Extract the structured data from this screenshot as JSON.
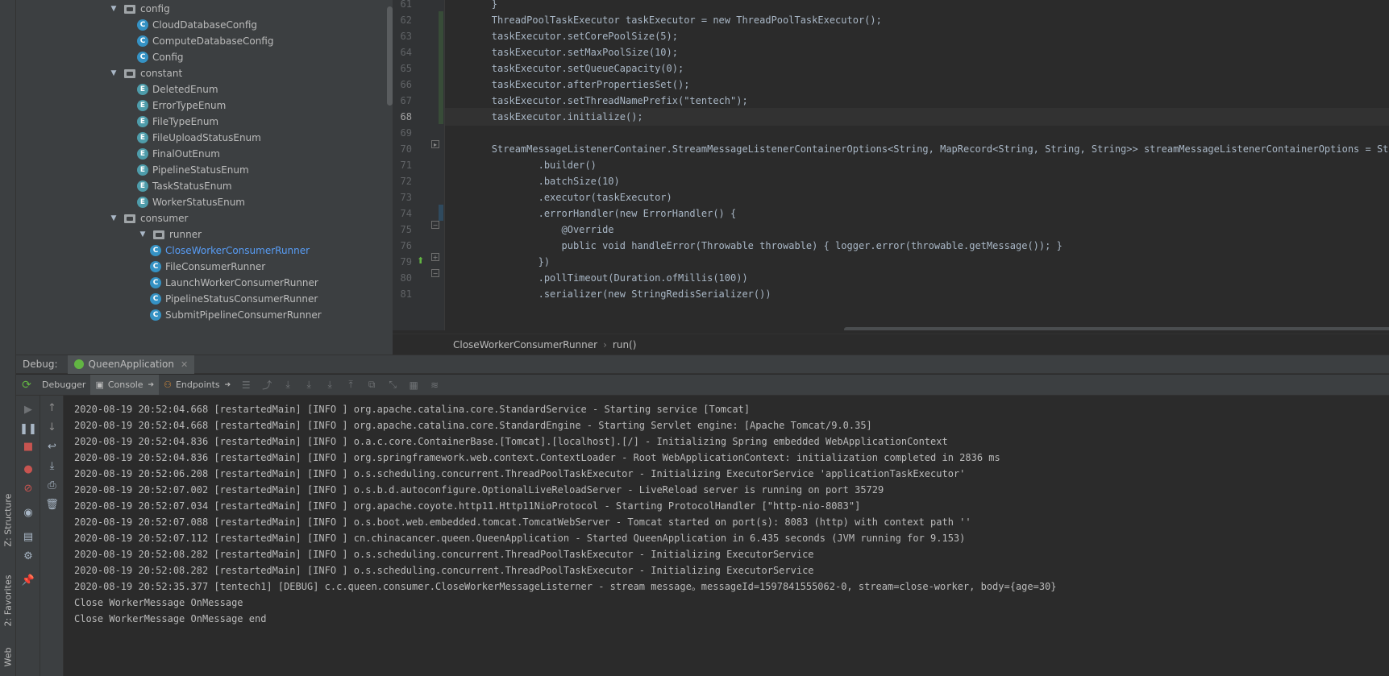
{
  "left_strip": {
    "structure": "Z: Structure",
    "favorites": "2: Favorites",
    "web": "Web"
  },
  "tree": [
    {
      "kind": "folder",
      "label": "config",
      "indent": 0,
      "expanded": true
    },
    {
      "kind": "class",
      "label": "CloudDatabaseConfig",
      "indent": 1
    },
    {
      "kind": "class",
      "label": "ComputeDatabaseConfig",
      "indent": 1
    },
    {
      "kind": "class",
      "label": "Config",
      "indent": 1
    },
    {
      "kind": "folder",
      "label": "constant",
      "indent": 0,
      "expanded": true
    },
    {
      "kind": "enum",
      "label": "DeletedEnum",
      "indent": 1
    },
    {
      "kind": "enum",
      "label": "ErrorTypeEnum",
      "indent": 1
    },
    {
      "kind": "enum",
      "label": "FileTypeEnum",
      "indent": 1
    },
    {
      "kind": "enum",
      "label": "FileUploadStatusEnum",
      "indent": 1
    },
    {
      "kind": "enum",
      "label": "FinalOutEnum",
      "indent": 1
    },
    {
      "kind": "enum",
      "label": "PipelineStatusEnum",
      "indent": 1
    },
    {
      "kind": "enum",
      "label": "TaskStatusEnum",
      "indent": 1
    },
    {
      "kind": "enum",
      "label": "WorkerStatusEnum",
      "indent": 1
    },
    {
      "kind": "folder",
      "label": "consumer",
      "indent": 0,
      "expanded": true
    },
    {
      "kind": "folder",
      "label": "runner",
      "indent": 1,
      "expanded": true
    },
    {
      "kind": "class",
      "label": "CloseWorkerConsumerRunner",
      "indent": 2,
      "selected": true
    },
    {
      "kind": "class",
      "label": "FileConsumerRunner",
      "indent": 2
    },
    {
      "kind": "class",
      "label": "LaunchWorkerConsumerRunner",
      "indent": 2
    },
    {
      "kind": "class",
      "label": "PipelineStatusConsumerRunner",
      "indent": 2
    },
    {
      "kind": "class",
      "label": "SubmitPipelineConsumerRunner",
      "indent": 2
    }
  ],
  "editor": {
    "lines": [
      {
        "num": "61",
        "code": "        }"
      },
      {
        "num": "62",
        "code": "        ThreadPoolTaskExecutor taskExecutor = new ThreadPoolTaskExecutor();"
      },
      {
        "num": "63",
        "code": "        taskExecutor.setCorePoolSize(5);"
      },
      {
        "num": "64",
        "code": "        taskExecutor.setMaxPoolSize(10);"
      },
      {
        "num": "65",
        "code": "        taskExecutor.setQueueCapacity(0);"
      },
      {
        "num": "66",
        "code": "        taskExecutor.afterPropertiesSet();"
      },
      {
        "num": "67",
        "code": "        taskExecutor.setThreadNamePrefix(\"tentech\");"
      },
      {
        "num": "68",
        "code": "        taskExecutor.initialize();",
        "current": true
      },
      {
        "num": "69",
        "code": ""
      },
      {
        "num": "70",
        "code": "        StreamMessageListenerContainer.StreamMessageListenerContainerOptions<String, MapRecord<String, String, String>> streamMessageListenerContainerOptions = StreamM"
      },
      {
        "num": "71",
        "code": "                .builder()"
      },
      {
        "num": "72",
        "code": "                .batchSize(10)"
      },
      {
        "num": "73",
        "code": "                .executor(taskExecutor)"
      },
      {
        "num": "74",
        "code": "                .errorHandler(new ErrorHandler() {"
      },
      {
        "num": "75",
        "code": "                    @Override"
      },
      {
        "num": "76",
        "code": "                    public void handleError(Throwable throwable) { logger.error(throwable.getMessage()); }"
      },
      {
        "num": "79",
        "code": "                })"
      },
      {
        "num": "80",
        "code": "                .pollTimeout(Duration.ofMillis(100))"
      },
      {
        "num": "81",
        "code": "                .serializer(new StringRedisSerializer())"
      }
    ],
    "breadcrumb": [
      "CloseWorkerConsumerRunner",
      "run()"
    ]
  },
  "debug": {
    "title": "Debug:",
    "run_config": "QueenApplication",
    "tabs": [
      "Debugger",
      "Console",
      "Endpoints"
    ],
    "active_tab": "Console"
  },
  "console": [
    "2020-08-19 20:52:04.668 [restartedMain] [INFO ] org.apache.catalina.core.StandardService - Starting service [Tomcat]",
    "2020-08-19 20:52:04.668 [restartedMain] [INFO ] org.apache.catalina.core.StandardEngine - Starting Servlet engine: [Apache Tomcat/9.0.35]",
    "2020-08-19 20:52:04.836 [restartedMain] [INFO ] o.a.c.core.ContainerBase.[Tomcat].[localhost].[/] - Initializing Spring embedded WebApplicationContext",
    "2020-08-19 20:52:04.836 [restartedMain] [INFO ] org.springframework.web.context.ContextLoader - Root WebApplicationContext: initialization completed in 2836 ms",
    "2020-08-19 20:52:06.208 [restartedMain] [INFO ] o.s.scheduling.concurrent.ThreadPoolTaskExecutor - Initializing ExecutorService 'applicationTaskExecutor'",
    "2020-08-19 20:52:07.002 [restartedMain] [INFO ] o.s.b.d.autoconfigure.OptionalLiveReloadServer - LiveReload server is running on port 35729",
    "2020-08-19 20:52:07.034 [restartedMain] [INFO ] org.apache.coyote.http11.Http11NioProtocol - Starting ProtocolHandler [\"http-nio-8083\"]",
    "2020-08-19 20:52:07.088 [restartedMain] [INFO ] o.s.boot.web.embedded.tomcat.TomcatWebServer - Tomcat started on port(s): 8083 (http) with context path ''",
    "2020-08-19 20:52:07.112 [restartedMain] [INFO ] cn.chinacancer.queen.QueenApplication - Started QueenApplication in 6.435 seconds (JVM running for 9.153)",
    "2020-08-19 20:52:08.282 [restartedMain] [INFO ] o.s.scheduling.concurrent.ThreadPoolTaskExecutor - Initializing ExecutorService",
    "2020-08-19 20:52:08.282 [restartedMain] [INFO ] o.s.scheduling.concurrent.ThreadPoolTaskExecutor - Initializing ExecutorService",
    "2020-08-19 20:52:35.377 [tentech1] [DEBUG] c.c.queen.consumer.CloseWorkerMessageListerner - stream message。messageId=1597841555062-0, stream=close-worker, body={age=30}",
    "Close WorkerMessage OnMessage",
    "Close WorkerMessage OnMessage end"
  ]
}
